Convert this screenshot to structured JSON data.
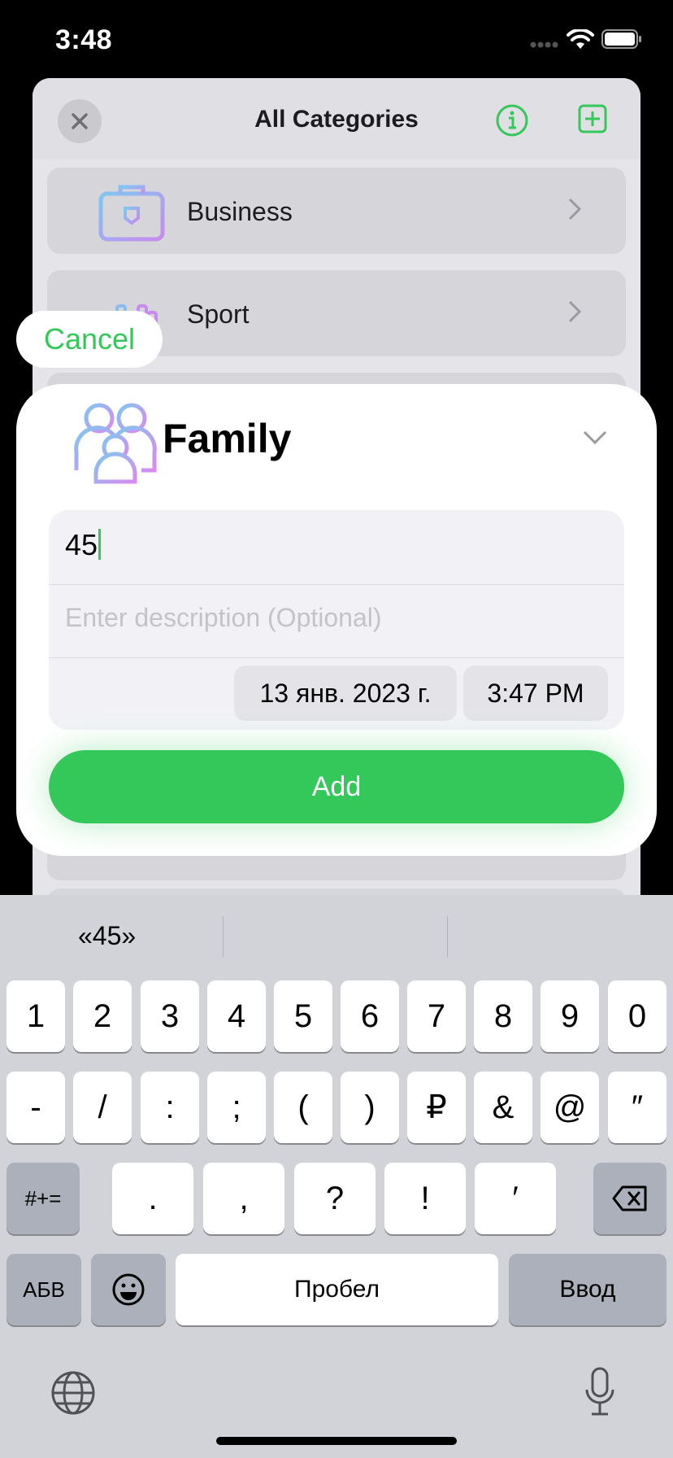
{
  "status_bar": {
    "time": "3:48"
  },
  "sheet": {
    "title": "All Categories",
    "categories": [
      {
        "label": "Business",
        "icon": "briefcase-icon"
      },
      {
        "label": "Sport",
        "icon": "dumbbell-icon"
      }
    ]
  },
  "cancel_label": "Cancel",
  "entry": {
    "category": "Family",
    "category_icon": "family-icon",
    "amount": "45",
    "description_placeholder": "Enter description (Optional)",
    "date": "13 янв. 2023 г.",
    "time": "3:47 PM",
    "add_label": "Add"
  },
  "colors": {
    "accent": "#34c759"
  },
  "keyboard": {
    "suggestion": "«45»",
    "row1": [
      "1",
      "2",
      "3",
      "4",
      "5",
      "6",
      "7",
      "8",
      "9",
      "0"
    ],
    "row2": [
      "-",
      "/",
      ":",
      ";",
      "(",
      ")",
      "₽",
      "&",
      "@",
      "″"
    ],
    "row3": [
      ".",
      ",",
      "?",
      "!",
      "′"
    ],
    "shift_label": "#+=",
    "abc_label": "АБВ",
    "space_label": "Пробел",
    "return_label": "Ввод"
  }
}
